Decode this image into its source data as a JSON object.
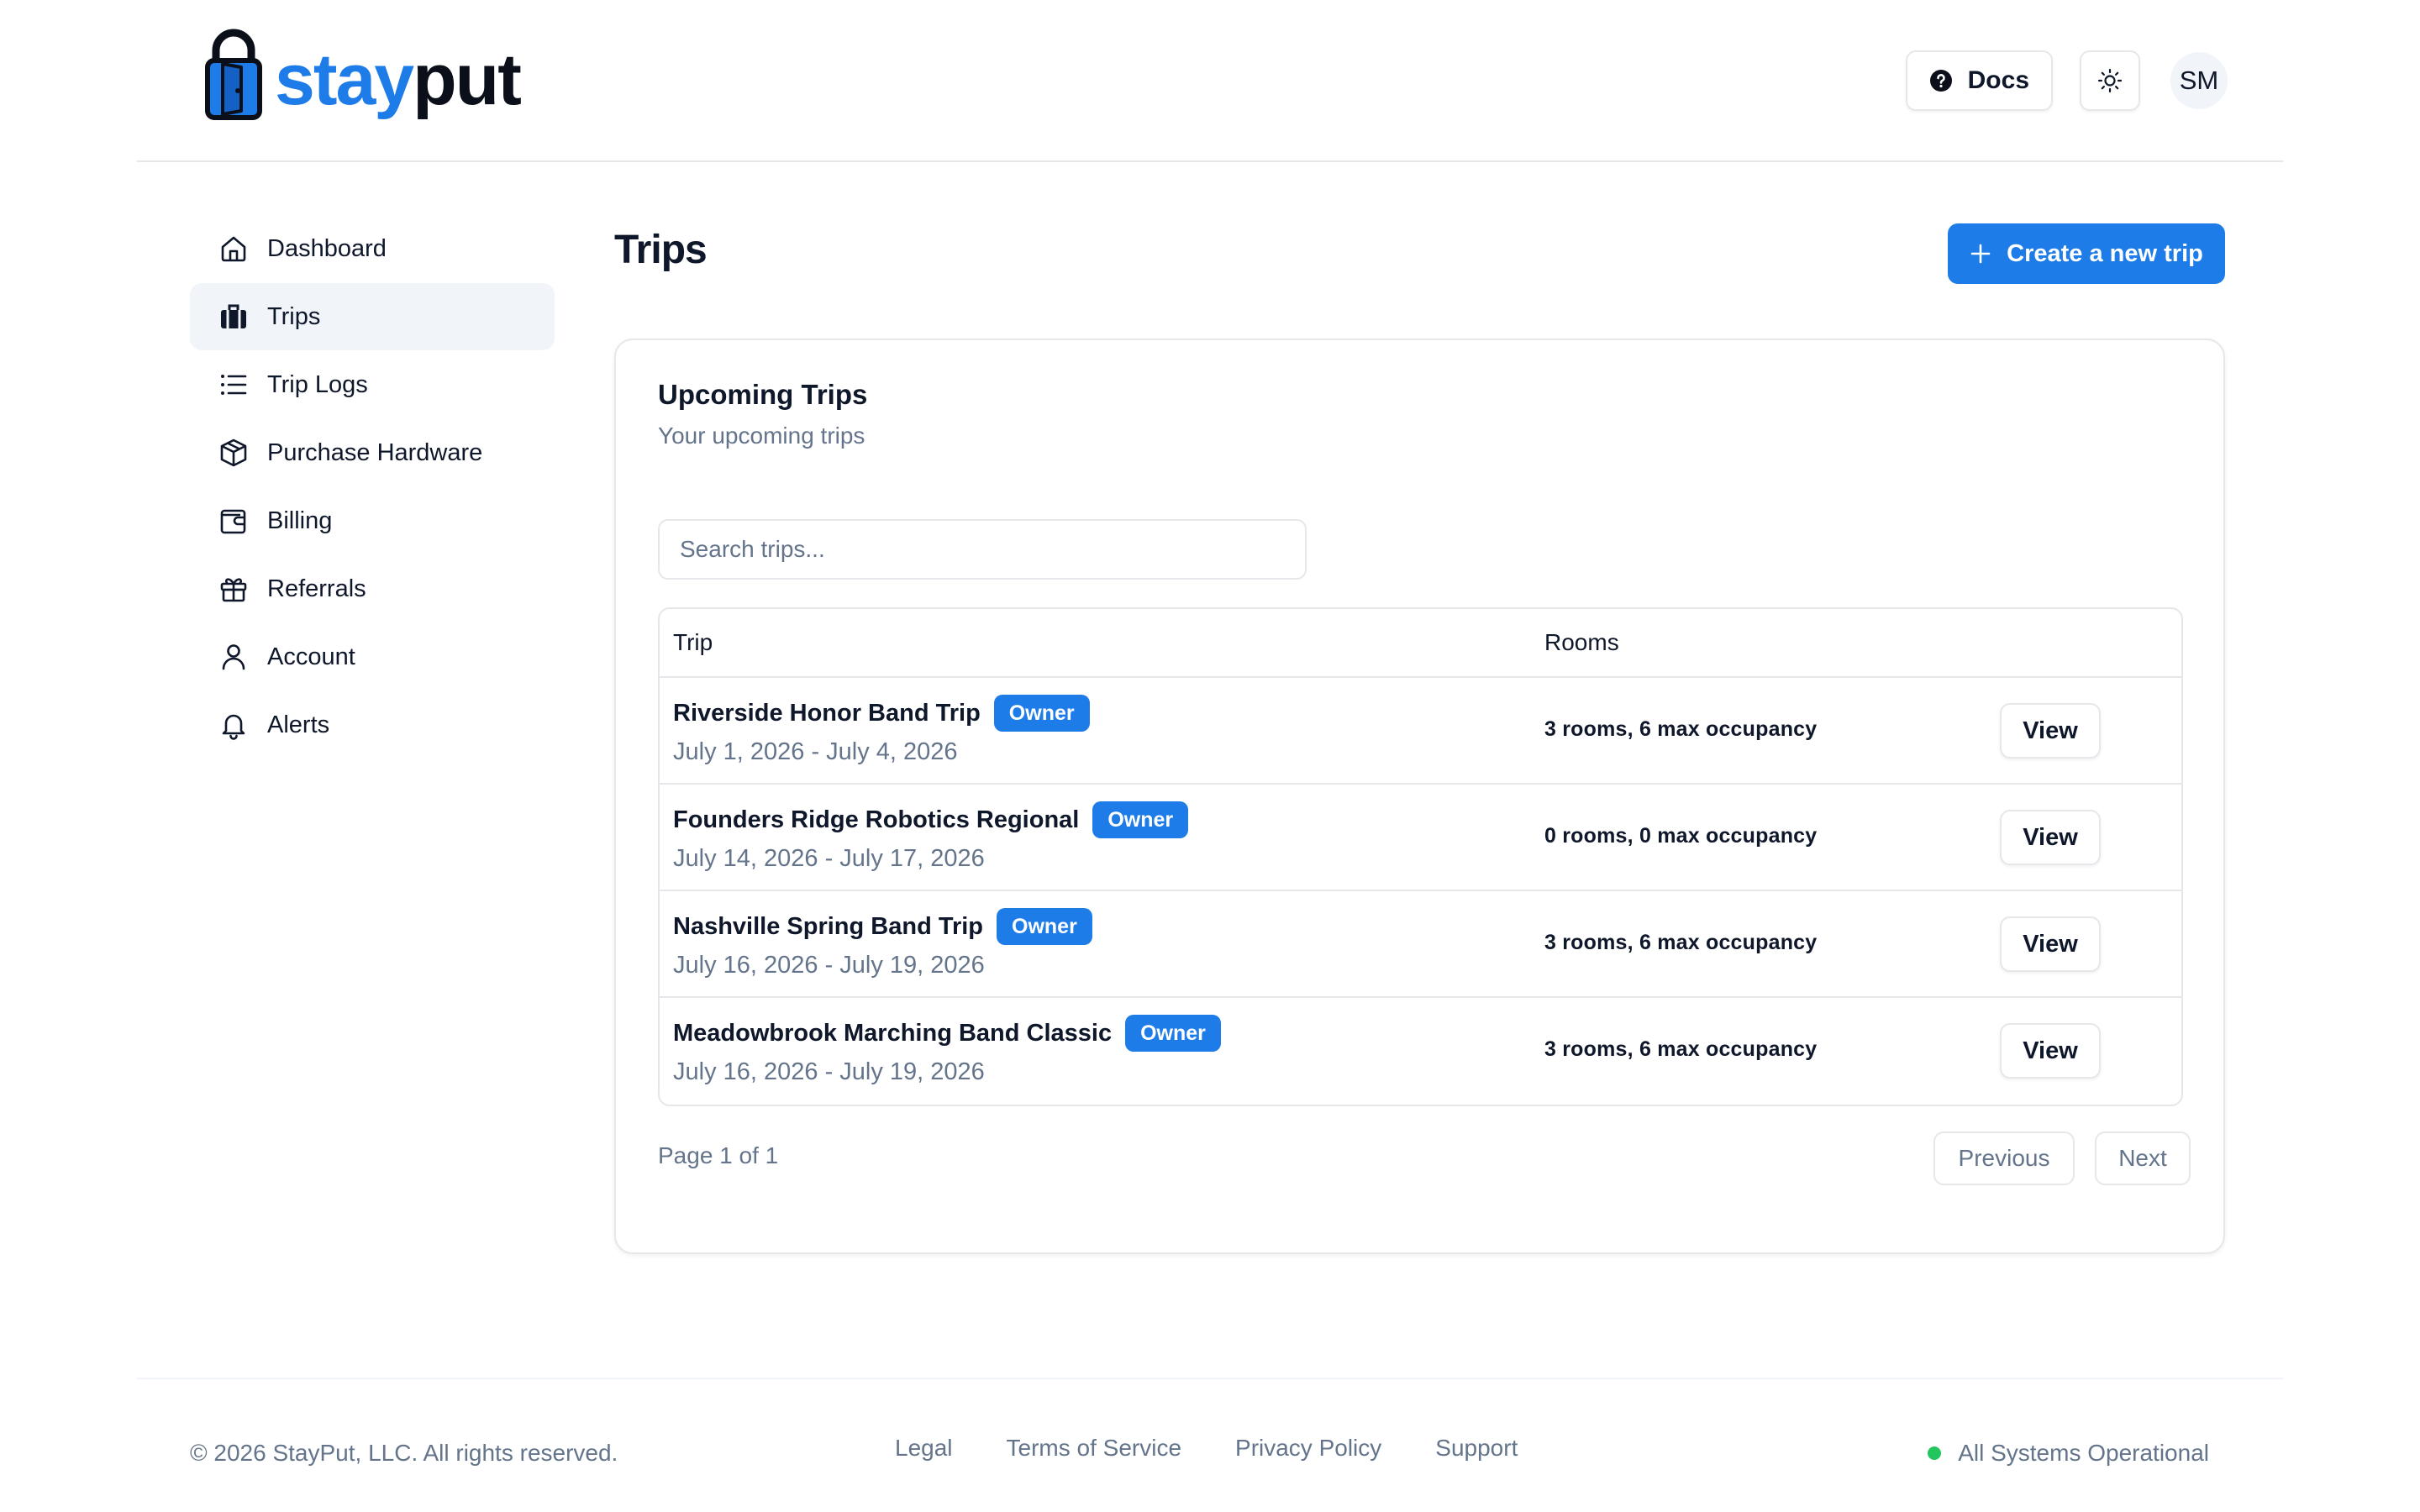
{
  "brand": {
    "part1": "stay",
    "part2": "put"
  },
  "header": {
    "docs_label": "Docs",
    "user_initials": "SM"
  },
  "sidebar": {
    "items": [
      {
        "label": "Dashboard",
        "icon": "home-icon",
        "active": false
      },
      {
        "label": "Trips",
        "icon": "luggage-icon",
        "active": true
      },
      {
        "label": "Trip Logs",
        "icon": "list-icon",
        "active": false
      },
      {
        "label": "Purchase Hardware",
        "icon": "package-icon",
        "active": false
      },
      {
        "label": "Billing",
        "icon": "wallet-icon",
        "active": false
      },
      {
        "label": "Referrals",
        "icon": "gift-icon",
        "active": false
      },
      {
        "label": "Account",
        "icon": "user-icon",
        "active": false
      },
      {
        "label": "Alerts",
        "icon": "bell-icon",
        "active": false
      }
    ]
  },
  "main": {
    "title": "Trips",
    "create_label": "Create a new trip",
    "card": {
      "title": "Upcoming Trips",
      "subtitle": "Your upcoming trips",
      "search_placeholder": "Search trips...",
      "columns": {
        "trip": "Trip",
        "rooms": "Rooms"
      },
      "rows": [
        {
          "name": "Riverside Honor Band Trip",
          "badge": "Owner",
          "dates": "July 1, 2026 - July 4, 2026",
          "rooms": "3 rooms, 6 max occupancy",
          "action": "View"
        },
        {
          "name": "Founders Ridge Robotics Regional",
          "badge": "Owner",
          "dates": "July 14, 2026 - July 17, 2026",
          "rooms": "0 rooms, 0 max occupancy",
          "action": "View"
        },
        {
          "name": "Nashville Spring Band Trip",
          "badge": "Owner",
          "dates": "July 16, 2026 - July 19, 2026",
          "rooms": "3 rooms, 6 max occupancy",
          "action": "View"
        },
        {
          "name": "Meadowbrook Marching Band Classic",
          "badge": "Owner",
          "dates": "July 16, 2026 - July 19, 2026",
          "rooms": "3 rooms, 6 max occupancy",
          "action": "View"
        }
      ],
      "pagination": {
        "info": "Page 1 of 1",
        "previous": "Previous",
        "next": "Next"
      }
    }
  },
  "footer": {
    "copyright": "© 2026 StayPut, LLC. All rights reserved.",
    "links": [
      "Legal",
      "Terms of Service",
      "Privacy Policy",
      "Support"
    ],
    "status": "All Systems Operational"
  },
  "colors": {
    "accent": "#1e7ce8",
    "status_ok": "#22c55e",
    "muted_text": "#64748b",
    "border": "#e5e7eb"
  }
}
